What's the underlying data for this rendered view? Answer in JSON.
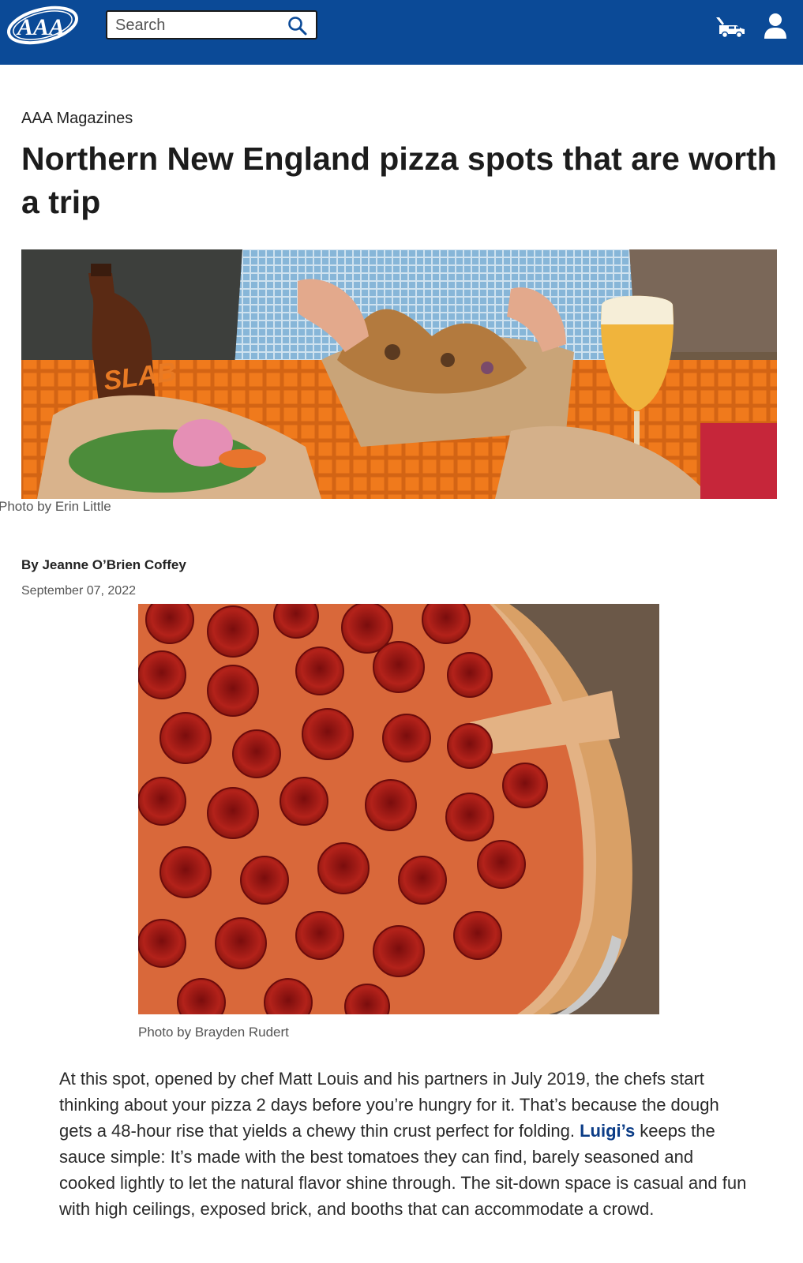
{
  "header": {
    "logo_alt": "AAA",
    "search": {
      "placeholder": "Search",
      "value": ""
    },
    "icons": [
      "tow-truck-icon",
      "user-account-icon"
    ],
    "brand_color": "#0b4a97"
  },
  "article": {
    "kicker": "AAA Magazines",
    "title": "Northern New England pizza spots that are worth a trip",
    "hero_credit": "Photo by Erin Little",
    "byline": "By Jeanne O’Brien Coffey",
    "date": "September 07, 2022",
    "second_credit": "Photo by Brayden Rudert",
    "paragraph": {
      "before_link": "At this spot, opened by chef Matt Louis and his partners in July 2019, the chefs start thinking about your pizza 2 days before you’re hungry for it. That’s because the dough gets a 48-hour rise that yields a chewy thin crust perfect for folding. ",
      "link_text": "Luigi’s",
      "after_link": " keeps the sauce simple: It’s made with the best tomatoes they can find, barely seasoned and cooked lightly to let the natural flavor shine through. The sit-down space is casual and fun with high ceilings, exposed brick, and booths that can accommodate a crowd."
    },
    "link_color": "#0b3c86"
  }
}
